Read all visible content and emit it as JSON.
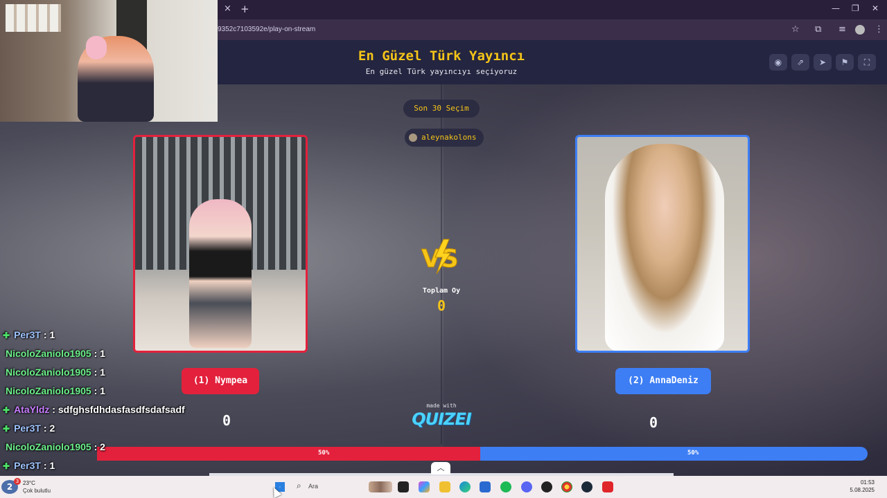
{
  "browser": {
    "url": "9352c7103592e/play-on-stream",
    "tab_close": "×",
    "tab_new": "+"
  },
  "page": {
    "title": "En Güzel Türk Yayıncı",
    "subtitle": "En güzel Türk yayıncıyı seçiyoruz",
    "last_picks_label": "Son 30 Seçim",
    "voter_name": "aleynakolons",
    "left": {
      "name_label": "(1) Nympea",
      "score": "0",
      "percent_label": "50%",
      "percent": 50,
      "color": "#e3213c"
    },
    "right": {
      "name_label": "(2) AnnaDeniz",
      "score": "0",
      "percent_label": "50%",
      "percent": 50,
      "color": "#3d7ef5"
    },
    "vs_label": "VS",
    "total_label": "Toplam Oy",
    "total_value": "0",
    "made_with": "made with",
    "brand": "QUIZEI",
    "accent": "#f5c518"
  },
  "chat": [
    {
      "badge": true,
      "user": "Per3T",
      "sep": " : ",
      "msg": "1",
      "cls": "u-blue"
    },
    {
      "badge": false,
      "user": "NicoloZaniolo1905",
      "sep": " : ",
      "msg": "1",
      "cls": "u-green"
    },
    {
      "badge": false,
      "user": "NicoloZaniolo1905",
      "sep": " : ",
      "msg": "1",
      "cls": "u-green"
    },
    {
      "badge": false,
      "user": "NicoloZaniolo1905",
      "sep": " : ",
      "msg": "1",
      "cls": "u-green"
    },
    {
      "badge": true,
      "user": "AtaYldz",
      "sep": " : ",
      "msg": "sdfghsfdhdasfasdfsdafsadf",
      "cls": "u-purple"
    },
    {
      "badge": true,
      "user": "Per3T",
      "sep": " : ",
      "msg": "2",
      "cls": "u-blue"
    },
    {
      "badge": false,
      "user": "NicoloZaniolo1905",
      "sep": " : ",
      "msg": "2",
      "cls": "u-green"
    },
    {
      "badge": true,
      "user": "Per3T",
      "sep": " : ",
      "msg": "1",
      "cls": "u-blue"
    }
  ],
  "taskbar": {
    "weather_count": "2",
    "weather_badge": "3",
    "temperature": "23°C",
    "weather_desc": "Çok bulutlu",
    "search_placeholder": "Ara",
    "time": "01:53",
    "date": "5.08.2025"
  }
}
